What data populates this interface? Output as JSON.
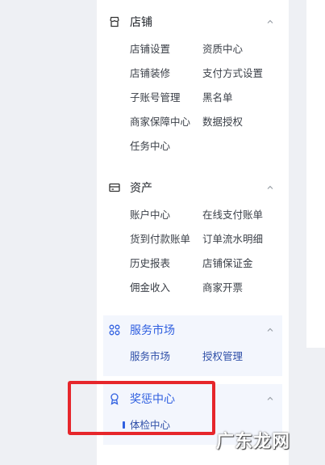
{
  "sections": [
    {
      "title": "店铺",
      "icon": "store-icon",
      "items": [
        "店铺设置",
        "资质中心",
        "店铺装修",
        "支付方式设置",
        "子账号管理",
        "黑名单",
        "商家保障中心",
        "数据授权",
        "任务中心"
      ]
    },
    {
      "title": "资产",
      "icon": "wallet-icon",
      "items": [
        "账户中心",
        "在线支付账单",
        "货到付款账单",
        "订单流水明细",
        "历史报表",
        "店铺保证金",
        "佣金收入",
        "商家开票"
      ]
    },
    {
      "title": "服务市场",
      "icon": "apps-icon",
      "items": [
        "服务市场",
        "授权管理"
      ]
    },
    {
      "title": "奖惩中心",
      "icon": "award-icon",
      "items": [
        "体检中心"
      ],
      "active_item": "体检中心"
    }
  ],
  "watermark": "广东龙网",
  "colors": {
    "accent": "#2f5fe0",
    "highlight_bg": "#f3f6fd",
    "annotation_red": "#e6262b"
  }
}
